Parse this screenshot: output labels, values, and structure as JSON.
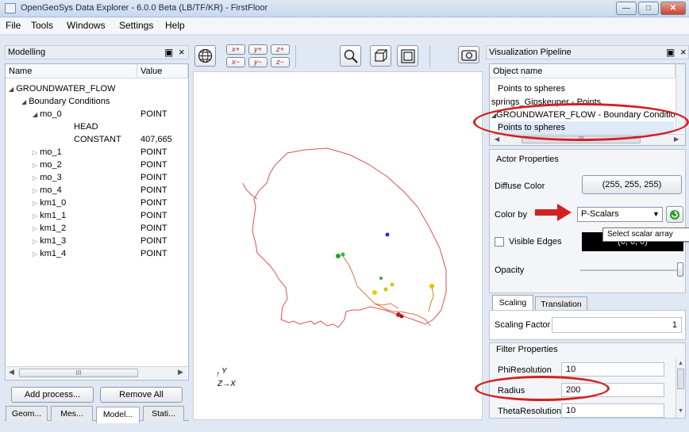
{
  "window": {
    "title": "OpenGeoSys Data Explorer - 6.0.0 Beta (LB/TF/KR) - FirstFloor"
  },
  "menu": [
    "File",
    "Tools",
    "Windows",
    "Settings",
    "Help"
  ],
  "modelling": {
    "title": "Modelling",
    "dock_controls": "\u0001 ×",
    "columns": [
      "Name",
      "Value"
    ],
    "tree": [
      {
        "name": "GROUNDWATER_FLOW",
        "value": ""
      },
      {
        "name": "Boundary Conditions",
        "value": ""
      },
      {
        "name": "mo_0",
        "value": "POINT"
      },
      {
        "name": "HEAD",
        "value": ""
      },
      {
        "name": "CONSTANT",
        "value": "407,665"
      },
      {
        "name": "mo_1",
        "value": "POINT"
      },
      {
        "name": "mo_2",
        "value": "POINT"
      },
      {
        "name": "mo_3",
        "value": "POINT"
      },
      {
        "name": "mo_4",
        "value": "POINT"
      },
      {
        "name": "km1_0",
        "value": "POINT"
      },
      {
        "name": "km1_1",
        "value": "POINT"
      },
      {
        "name": "km1_2",
        "value": "POINT"
      },
      {
        "name": "km1_3",
        "value": "POINT"
      },
      {
        "name": "km1_4",
        "value": "POINT"
      }
    ],
    "scroll_mark": "III",
    "add_process": "Add process...",
    "remove_all": "Remove All",
    "tabs": [
      "Geom...",
      "Mes...",
      "Model...",
      "Stati..."
    ]
  },
  "toolbar": {
    "axis_buttons": [
      "x+",
      "y+",
      "z+",
      "x−",
      "y−",
      "z−"
    ]
  },
  "viewport": {
    "axis_y": "Y",
    "axis_zx": "Z→X"
  },
  "pipeline": {
    "title": "Visualization Pipeline",
    "column": "Object name",
    "items": [
      "Points to spheres",
      "springs_Gipskeuper - Points",
      "GROUNDWATER_FLOW - Boundary Condition",
      "Points to spheres"
    ],
    "scroll_mark": "III"
  },
  "actor": {
    "title": "Actor Properties",
    "diffuse_label": "Diffuse Color",
    "diffuse_value": "(255, 255, 255)",
    "color_by_label": "Color by",
    "color_by_value": "P-Scalars",
    "tooltip": "Select scalar array",
    "visible_edges_label": "Visible Edges",
    "edge_color_value": "(0, 0, 0)",
    "opacity_label": "Opacity"
  },
  "scaling": {
    "tabs": [
      "Scaling",
      "Translation"
    ],
    "factor_label": "Scaling Factor",
    "factor_value": "1"
  },
  "filter": {
    "title": "Filter Properties",
    "rows": [
      {
        "label": "PhiResolution",
        "value": "10"
      },
      {
        "label": "Radius",
        "value": "200"
      },
      {
        "label": "ThetaResolution",
        "value": "10"
      }
    ]
  },
  "colors": {
    "highlight": "#d42020",
    "polygon": "#e05050",
    "edge_box": "#000000"
  }
}
